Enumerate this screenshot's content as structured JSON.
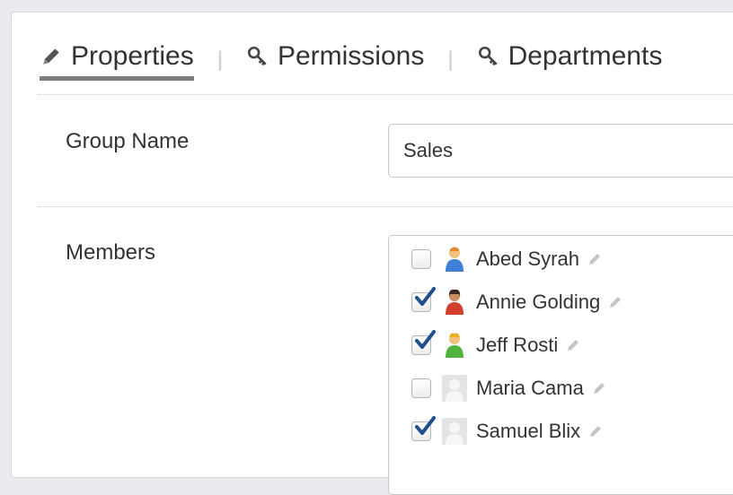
{
  "tabs": [
    {
      "label": "Properties",
      "icon": "pencil-icon",
      "active": true
    },
    {
      "label": "Permissions",
      "icon": "key-icon",
      "active": false
    },
    {
      "label": "Departments",
      "icon": "key-icon",
      "active": false
    }
  ],
  "tab_separator": "|",
  "form": {
    "group_name_label": "Group Name",
    "group_name_value": "Sales",
    "members_label": "Members"
  },
  "members": [
    {
      "name": "Abed Syrah",
      "checked": false,
      "avatar": "blue-person-avatar"
    },
    {
      "name": "Annie Golding",
      "checked": true,
      "avatar": "red-person-avatar"
    },
    {
      "name": "Jeff Rosti",
      "checked": true,
      "avatar": "green-person-avatar"
    },
    {
      "name": "Maria Cama",
      "checked": false,
      "avatar": "placeholder-avatar"
    },
    {
      "name": "Samuel Blix",
      "checked": true,
      "avatar": "placeholder-avatar"
    }
  ],
  "colors": {
    "check": "#1f4f8f",
    "active_tab_underline": "#7c7c7c"
  }
}
